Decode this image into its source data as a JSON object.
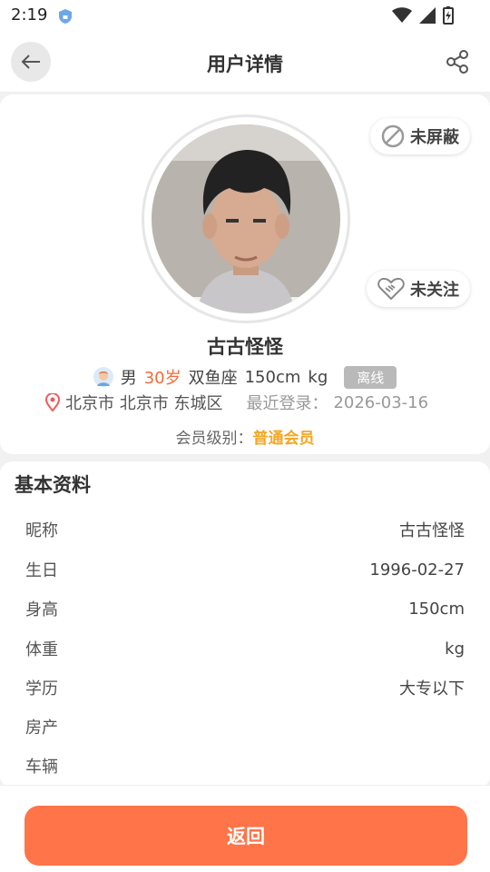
{
  "status": {
    "time": "2:19"
  },
  "header": {
    "title": "用户详情"
  },
  "profile": {
    "block_label": "未屏蔽",
    "follow_label": "未关注",
    "name": "古古怪怪",
    "gender": "男",
    "age": "30岁",
    "zodiac": "双鱼座",
    "height": "150cm",
    "weight": "kg",
    "online_status": "离线",
    "location": "北京市 北京市 东城区",
    "last_login_label": "最近登录：",
    "last_login_date": "2026-03-16",
    "member_label": "会员级别：",
    "member_level": "普通会员"
  },
  "basic": {
    "title": "基本资料",
    "rows": [
      {
        "label": "昵称",
        "value": "古古怪怪"
      },
      {
        "label": "生日",
        "value": "1996-02-27"
      },
      {
        "label": "身高",
        "value": "150cm"
      },
      {
        "label": "体重",
        "value": "kg"
      },
      {
        "label": "学历",
        "value": "大专以下"
      },
      {
        "label": "房产",
        "value": ""
      },
      {
        "label": "车辆",
        "value": ""
      }
    ]
  },
  "footer": {
    "return_label": "返回"
  },
  "colors": {
    "accent": "#ff7448",
    "age": "#f26b3a",
    "member": "#f5a623"
  }
}
